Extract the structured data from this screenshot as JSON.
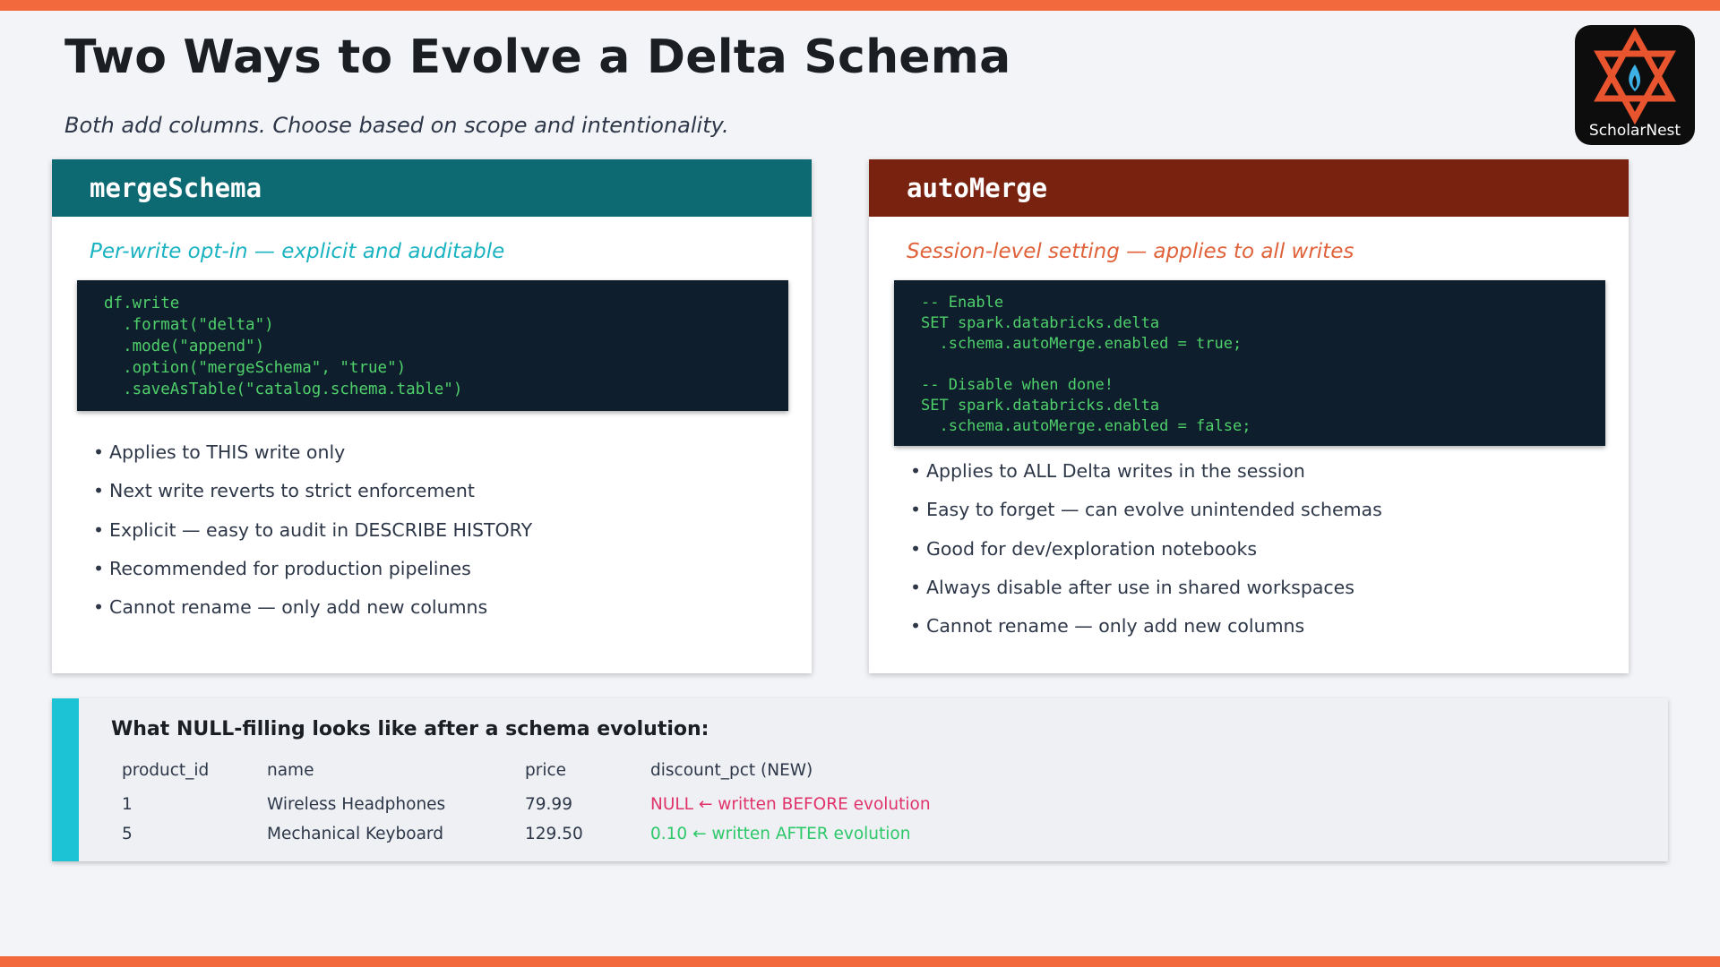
{
  "slide": {
    "title": "Two Ways to Evolve a Delta Schema",
    "subtitle": "Both add columns. Choose based on scope and intentionality."
  },
  "logo": {
    "text": "ScholarNest",
    "icon": "star-of-david-flame-icon"
  },
  "colors": {
    "accent_orange": "#f2693e",
    "merge_header": "#0d6a72",
    "auto_header": "#7a2210",
    "merge_tagline": "#1ab3c1",
    "auto_tagline": "#e0623a",
    "code_bg": "#0f1e2c",
    "code_text": "#4ed06a",
    "panel_accent": "#1cc3d4",
    "null_text": "#e0336a",
    "new_text": "#2dc86a"
  },
  "merge_card": {
    "header": "mergeSchema",
    "tagline": "Per-write opt-in — explicit and auditable",
    "code": "df.write\n  .format(\"delta\")\n  .mode(\"append\")\n  .option(\"mergeSchema\", \"true\")\n  .saveAsTable(\"catalog.schema.table\")",
    "bullets": [
      "Applies to THIS write only",
      "Next write reverts to strict enforcement",
      "Explicit — easy to audit in DESCRIBE HISTORY",
      "Recommended for production pipelines",
      "Cannot rename — only add new columns"
    ]
  },
  "auto_card": {
    "header": "autoMerge",
    "tagline": "Session-level setting — applies to all writes",
    "code": "-- Enable\nSET spark.databricks.delta\n  .schema.autoMerge.enabled = true;\n\n-- Disable when done!\nSET spark.databricks.delta\n  .schema.autoMerge.enabled = false;",
    "bullets": [
      "Applies to ALL Delta writes in the session",
      "Easy to forget — can evolve unintended schemas",
      "Good for dev/exploration notebooks",
      "Always disable after use in shared workspaces",
      "Cannot rename — only add new columns"
    ]
  },
  "null_panel": {
    "title": "What NULL-filling looks like after a schema evolution:",
    "columns": [
      "product_id",
      "name",
      "price",
      "discount_pct (NEW)"
    ],
    "rows": [
      {
        "product_id": "1",
        "name": "Wireless Headphones",
        "price": "79.99",
        "discount": "NULL  ← written BEFORE evolution"
      },
      {
        "product_id": "5",
        "name": "Mechanical Keyboard",
        "price": "129.50",
        "discount": "0.10  ← written AFTER evolution"
      }
    ]
  }
}
